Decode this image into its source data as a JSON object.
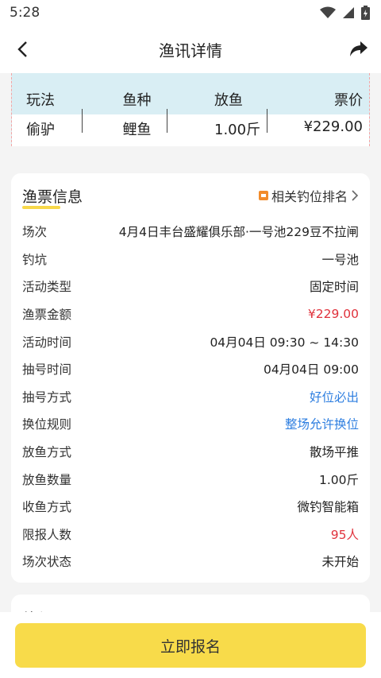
{
  "status": {
    "time": "5:28"
  },
  "nav": {
    "title": "渔讯详情"
  },
  "banner": {
    "headers": [
      "玩法",
      "鱼种",
      "放鱼",
      "票价"
    ],
    "values": [
      "偷驴",
      "鲤鱼",
      "1.00斤",
      "¥229.00"
    ]
  },
  "ticket": {
    "title": "渔票信息",
    "rank_link": "相关钓位排名",
    "rows": [
      {
        "label": "场次",
        "value": "4月4日丰台盛耀俱乐部·一号池229豆不拉闸"
      },
      {
        "label": "钓坑",
        "value": "一号池"
      },
      {
        "label": "活动类型",
        "value": "固定时间"
      },
      {
        "label": "渔票金额",
        "value": "¥229.00"
      },
      {
        "label": "活动时间",
        "value": "04月04日 09:30 ~ 14:30"
      },
      {
        "label": "抽号时间",
        "value": "04月04日 09:00"
      },
      {
        "label": "抽号方式",
        "value": "好位必出"
      },
      {
        "label": "换位规则",
        "value": "整场允许换位"
      },
      {
        "label": "放鱼方式",
        "value": "散场平推"
      },
      {
        "label": "放鱼数量",
        "value": "1.00斤"
      },
      {
        "label": "收鱼方式",
        "value": "微钓智能箱"
      },
      {
        "label": "限报人数",
        "value": "95人"
      },
      {
        "label": "场次状态",
        "value": "未开始"
      }
    ]
  },
  "second": {
    "title": "渔讯"
  },
  "bottom": {
    "signup": "立即报名"
  },
  "colors": {
    "accent": "#f8db4a",
    "red": "#e0323c",
    "blue": "#2f7fe0",
    "banner_bg": "#d9eef4"
  }
}
